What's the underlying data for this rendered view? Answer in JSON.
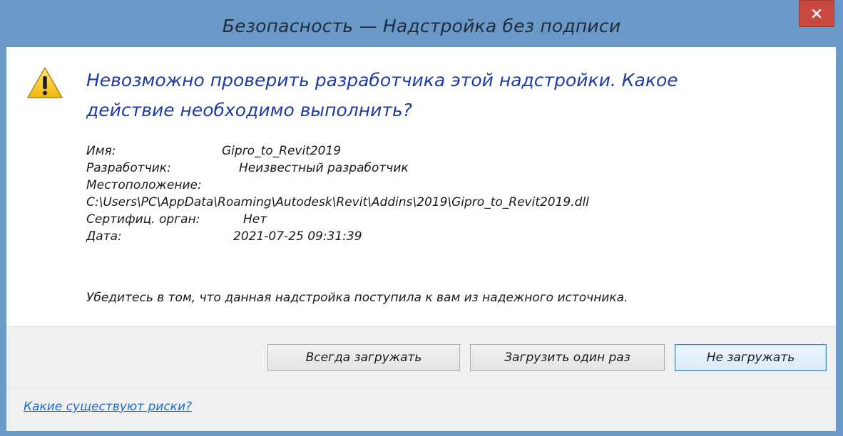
{
  "window": {
    "title": "Безопасность — Надстройка без подписи",
    "close_icon": "close-icon"
  },
  "message": {
    "icon": "warning-icon",
    "heading_line1": "Невозможно проверить разработчика этой надстройки. Какое",
    "heading_line2": "действие необходимо выполнить?"
  },
  "info": {
    "name_label": "Имя:",
    "name_value": "Gipro_to_Revit2019",
    "developer_label": "Разработчик:",
    "developer_value": "Неизвестный разработчик",
    "location_label": "Местоположение:",
    "location_value": "C:\\Users\\PC\\AppData\\Roaming\\Autodesk\\Revit\\Addins\\2019\\Gipro_to_Revit2019.dll",
    "cert_label": "Сертифиц. орган:",
    "cert_value": "Нет",
    "date_label": "Дата:",
    "date_value": "2021-07-25 09:31:39"
  },
  "note": "Убедитесь в том, что данная надстройка поступила к вам из надежного источника.",
  "buttons": {
    "always_load": "Всегда загружать",
    "load_once": "Загрузить один раз",
    "dont_load": "Не загружать"
  },
  "footer": {
    "risk_link": "Какие существуют риски?"
  },
  "colors": {
    "titlebar": "#6a99c8",
    "heading": "#1e3aa8",
    "link": "#1a6fd0",
    "close": "#c7493f"
  }
}
